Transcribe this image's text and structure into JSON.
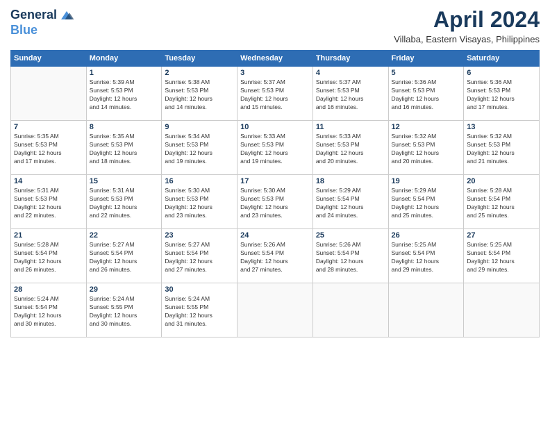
{
  "header": {
    "logo_line1": "General",
    "logo_line2": "Blue",
    "month_title": "April 2024",
    "location": "Villaba, Eastern Visayas, Philippines"
  },
  "weekdays": [
    "Sunday",
    "Monday",
    "Tuesday",
    "Wednesday",
    "Thursday",
    "Friday",
    "Saturday"
  ],
  "weeks": [
    [
      {
        "day": "",
        "info": ""
      },
      {
        "day": "1",
        "info": "Sunrise: 5:39 AM\nSunset: 5:53 PM\nDaylight: 12 hours\nand 14 minutes."
      },
      {
        "day": "2",
        "info": "Sunrise: 5:38 AM\nSunset: 5:53 PM\nDaylight: 12 hours\nand 14 minutes."
      },
      {
        "day": "3",
        "info": "Sunrise: 5:37 AM\nSunset: 5:53 PM\nDaylight: 12 hours\nand 15 minutes."
      },
      {
        "day": "4",
        "info": "Sunrise: 5:37 AM\nSunset: 5:53 PM\nDaylight: 12 hours\nand 16 minutes."
      },
      {
        "day": "5",
        "info": "Sunrise: 5:36 AM\nSunset: 5:53 PM\nDaylight: 12 hours\nand 16 minutes."
      },
      {
        "day": "6",
        "info": "Sunrise: 5:36 AM\nSunset: 5:53 PM\nDaylight: 12 hours\nand 17 minutes."
      }
    ],
    [
      {
        "day": "7",
        "info": "Sunrise: 5:35 AM\nSunset: 5:53 PM\nDaylight: 12 hours\nand 17 minutes."
      },
      {
        "day": "8",
        "info": "Sunrise: 5:35 AM\nSunset: 5:53 PM\nDaylight: 12 hours\nand 18 minutes."
      },
      {
        "day": "9",
        "info": "Sunrise: 5:34 AM\nSunset: 5:53 PM\nDaylight: 12 hours\nand 19 minutes."
      },
      {
        "day": "10",
        "info": "Sunrise: 5:33 AM\nSunset: 5:53 PM\nDaylight: 12 hours\nand 19 minutes."
      },
      {
        "day": "11",
        "info": "Sunrise: 5:33 AM\nSunset: 5:53 PM\nDaylight: 12 hours\nand 20 minutes."
      },
      {
        "day": "12",
        "info": "Sunrise: 5:32 AM\nSunset: 5:53 PM\nDaylight: 12 hours\nand 20 minutes."
      },
      {
        "day": "13",
        "info": "Sunrise: 5:32 AM\nSunset: 5:53 PM\nDaylight: 12 hours\nand 21 minutes."
      }
    ],
    [
      {
        "day": "14",
        "info": "Sunrise: 5:31 AM\nSunset: 5:53 PM\nDaylight: 12 hours\nand 22 minutes."
      },
      {
        "day": "15",
        "info": "Sunrise: 5:31 AM\nSunset: 5:53 PM\nDaylight: 12 hours\nand 22 minutes."
      },
      {
        "day": "16",
        "info": "Sunrise: 5:30 AM\nSunset: 5:53 PM\nDaylight: 12 hours\nand 23 minutes."
      },
      {
        "day": "17",
        "info": "Sunrise: 5:30 AM\nSunset: 5:53 PM\nDaylight: 12 hours\nand 23 minutes."
      },
      {
        "day": "18",
        "info": "Sunrise: 5:29 AM\nSunset: 5:54 PM\nDaylight: 12 hours\nand 24 minutes."
      },
      {
        "day": "19",
        "info": "Sunrise: 5:29 AM\nSunset: 5:54 PM\nDaylight: 12 hours\nand 25 minutes."
      },
      {
        "day": "20",
        "info": "Sunrise: 5:28 AM\nSunset: 5:54 PM\nDaylight: 12 hours\nand 25 minutes."
      }
    ],
    [
      {
        "day": "21",
        "info": "Sunrise: 5:28 AM\nSunset: 5:54 PM\nDaylight: 12 hours\nand 26 minutes."
      },
      {
        "day": "22",
        "info": "Sunrise: 5:27 AM\nSunset: 5:54 PM\nDaylight: 12 hours\nand 26 minutes."
      },
      {
        "day": "23",
        "info": "Sunrise: 5:27 AM\nSunset: 5:54 PM\nDaylight: 12 hours\nand 27 minutes."
      },
      {
        "day": "24",
        "info": "Sunrise: 5:26 AM\nSunset: 5:54 PM\nDaylight: 12 hours\nand 27 minutes."
      },
      {
        "day": "25",
        "info": "Sunrise: 5:26 AM\nSunset: 5:54 PM\nDaylight: 12 hours\nand 28 minutes."
      },
      {
        "day": "26",
        "info": "Sunrise: 5:25 AM\nSunset: 5:54 PM\nDaylight: 12 hours\nand 29 minutes."
      },
      {
        "day": "27",
        "info": "Sunrise: 5:25 AM\nSunset: 5:54 PM\nDaylight: 12 hours\nand 29 minutes."
      }
    ],
    [
      {
        "day": "28",
        "info": "Sunrise: 5:24 AM\nSunset: 5:54 PM\nDaylight: 12 hours\nand 30 minutes."
      },
      {
        "day": "29",
        "info": "Sunrise: 5:24 AM\nSunset: 5:55 PM\nDaylight: 12 hours\nand 30 minutes."
      },
      {
        "day": "30",
        "info": "Sunrise: 5:24 AM\nSunset: 5:55 PM\nDaylight: 12 hours\nand 31 minutes."
      },
      {
        "day": "",
        "info": ""
      },
      {
        "day": "",
        "info": ""
      },
      {
        "day": "",
        "info": ""
      },
      {
        "day": "",
        "info": ""
      }
    ]
  ]
}
